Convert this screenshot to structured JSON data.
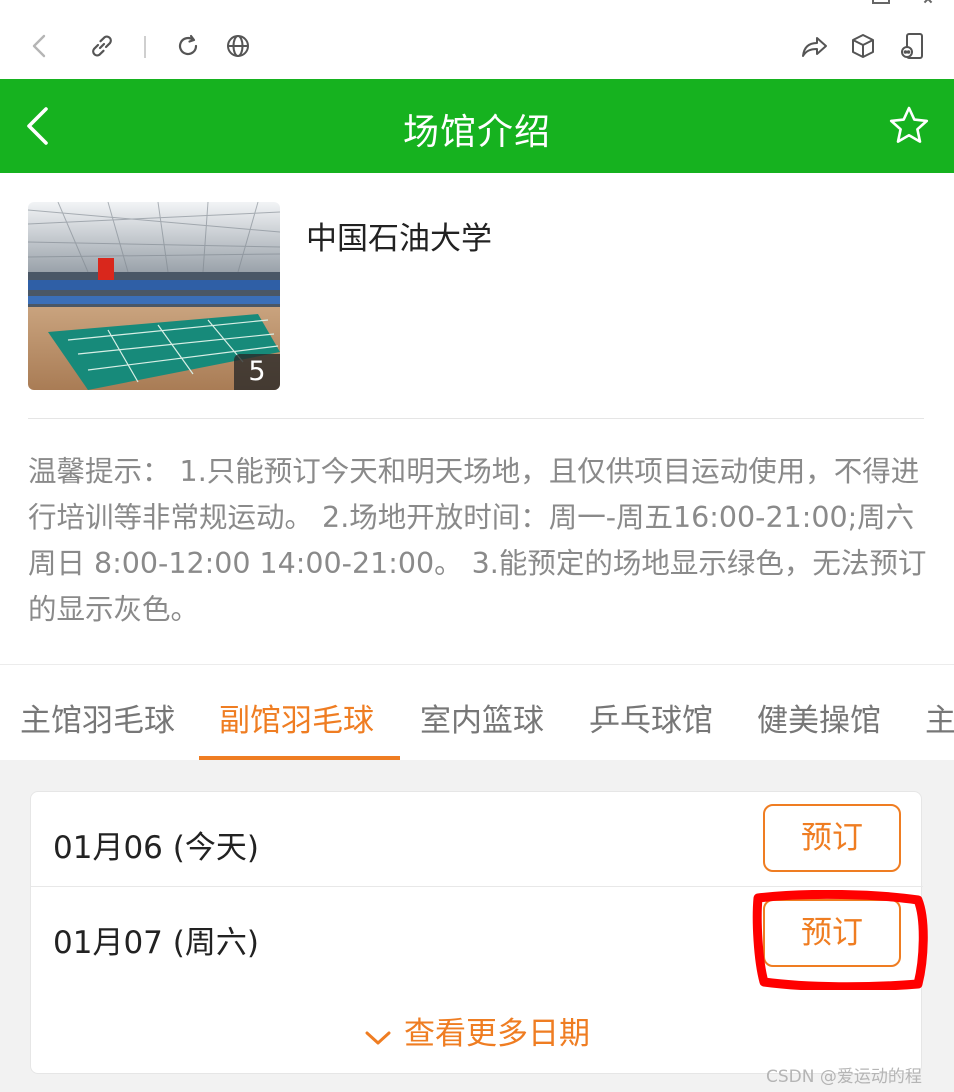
{
  "browser": {
    "icons": [
      "back-arrow-icon",
      "link-icon",
      "reload-icon",
      "globe-icon",
      "share-icon",
      "cube-icon",
      "phone-icon"
    ]
  },
  "header": {
    "title": "场馆介绍",
    "back_icon": "chevron-left-icon",
    "favorite_icon": "star-icon",
    "color": "#16b21f"
  },
  "venue": {
    "name": "中国石油大学",
    "photo_count": "5",
    "tip": "温馨提示： 1.只能预订今天和明天场地，且仅供项目运动使用，不得进行培训等非常规运动。 2.场地开放时间：周一-周五16:00-21:00;周六周日 8:00-12:00 14:00-21:00。 3.能预定的场地显示绿色，无法预订的显示灰色。"
  },
  "tabs": [
    {
      "label": "主馆羽毛球"
    },
    {
      "label": "副馆羽毛球",
      "active": true
    },
    {
      "label": "室内篮球"
    },
    {
      "label": "乒乓球馆"
    },
    {
      "label": "健美操馆"
    },
    {
      "label": "主"
    }
  ],
  "dates": [
    {
      "date": "01月06 (今天)",
      "button": "预订"
    },
    {
      "date": "01月07 (周六)",
      "button": "预订"
    }
  ],
  "more_dates": "查看更多日期",
  "accent_color": "#ef7d22",
  "watermark": "CSDN @爱运动的程"
}
